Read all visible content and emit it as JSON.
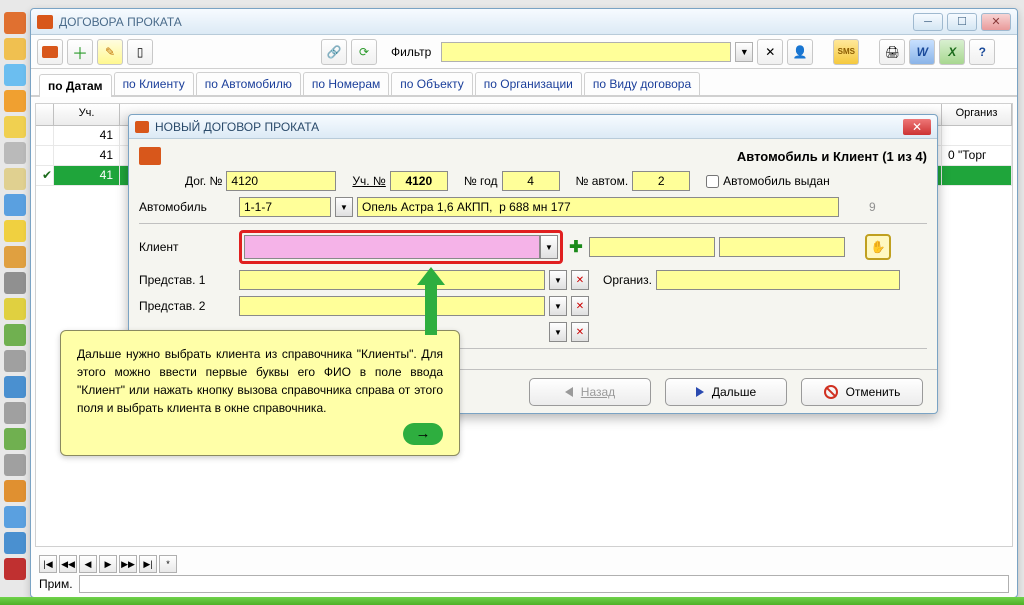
{
  "outer_window": {
    "title": "ДОГОВОРА ПРОКАТА",
    "filter_label": "Фильтр",
    "sms": "SMS"
  },
  "tabs": [
    "по Датам",
    "по Клиенту",
    "по Автомобилю",
    "по Номерам",
    "по Объекту",
    "по Организации",
    "по Виду договора"
  ],
  "grid": {
    "headers": [
      "",
      "Уч.",
      "",
      "Организ"
    ],
    "rows": [
      {
        "val": "41"
      },
      {
        "val": "41"
      },
      {
        "val": "41",
        "selected": true
      }
    ],
    "right_text": "0 \"Торг"
  },
  "prim_label": "Прим.",
  "dialog": {
    "title": "НОВЫЙ ДОГОВОР ПРОКАТА",
    "heading": "Автомобиль и Клиент (1 из 4)",
    "labels": {
      "dog_no": "Дог. №",
      "uch_no": "Уч. №",
      "no_god": "№ год",
      "no_avtom": "№ автом.",
      "auto_issued": "Автомобиль выдан",
      "auto": "Автомобиль",
      "client": "Клиент",
      "predstav1": "Представ. 1",
      "predstav2": "Представ. 2",
      "organiz": "Организ."
    },
    "values": {
      "dog_no": "4120",
      "uch_no": "4120",
      "no_god": "4",
      "no_avtom": "2",
      "auto_code": "1-1-7",
      "auto_desc": "Опель Астра 1,6 АКПП,  р 688 мн 177",
      "auto_seq": "9"
    },
    "buttons": {
      "back": "Назад",
      "next": "Дальше",
      "cancel": "Отменить"
    }
  },
  "tooltip": {
    "text": "Дальше нужно выбрать клиента из справочника \"Клиенты\". Для этого можно ввести первые буквы его ФИО в поле ввода \"Клиент\" или нажать кнопку вызова справочника справа от этого поля и выбрать клиента в окне справочника.",
    "next_arrow": "→"
  }
}
